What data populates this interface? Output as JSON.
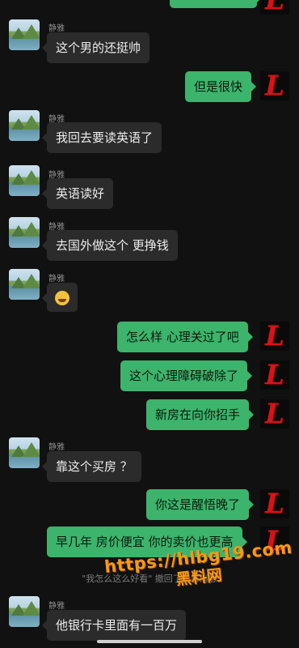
{
  "contact_name": "静雅",
  "messages": [
    {
      "from": "them",
      "text": "这个男的还挺帅"
    },
    {
      "from": "me",
      "text": "但是很快"
    },
    {
      "from": "them",
      "text": "我回去要读英语了"
    },
    {
      "from": "them",
      "text": "英语读好"
    },
    {
      "from": "them",
      "text": "去国外做这个 更挣钱"
    },
    {
      "from": "them",
      "emoji": "grinning-sweat-emoji"
    },
    {
      "from": "me",
      "text": "怎么样 心理关过了吧"
    },
    {
      "from": "me",
      "text": "这个心理障碍破除了"
    },
    {
      "from": "me",
      "text": "新房在向你招手"
    },
    {
      "from": "them",
      "text": "靠这个买房 ？"
    },
    {
      "from": "me",
      "text": "你这是醒悟晚了"
    },
    {
      "from": "me",
      "text": "早几年 房价便宜 你的卖价也更高"
    },
    {
      "from": "them",
      "text": "他银行卡里面有一百万"
    }
  ],
  "system_notice": "\"我怎么这么好看\" 撤回了一条消息",
  "my_avatar_letter": "L",
  "watermark": {
    "line1": "https://hlbg19.com",
    "line2": "黑料网"
  },
  "colors": {
    "background": "#111111",
    "incoming_bubble": "#2b2b2b",
    "outgoing_bubble": "#3cb46b",
    "avatar_letter": "#d4141a",
    "watermark": "#f39a19"
  }
}
